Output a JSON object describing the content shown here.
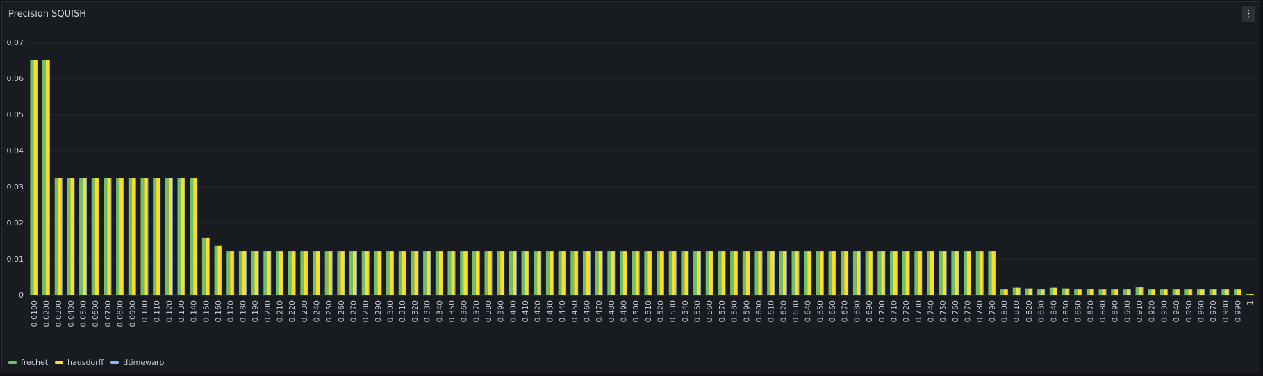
{
  "panel": {
    "title": "Precision SQUISH",
    "menu_icon": "more-vertical-icon"
  },
  "chart_data": {
    "type": "bar",
    "title": "Precision SQUISH",
    "xlabel": "",
    "ylabel": "",
    "ylim": [
      0,
      0.07
    ],
    "yticks": [
      0,
      0.01,
      0.02,
      0.03,
      0.04,
      0.05,
      0.06,
      0.07
    ],
    "ytick_labels": [
      "0",
      "0.01",
      "0.02",
      "0.03",
      "0.04",
      "0.05",
      "0.06",
      "0.07"
    ],
    "grid": true,
    "legend_position": "bottom-left",
    "categories": [
      "0.0100",
      "0.0200",
      "0.0300",
      "0.0400",
      "0.0500",
      "0.0600",
      "0.0700",
      "0.0800",
      "0.0900",
      "0.100",
      "0.110",
      "0.120",
      "0.130",
      "0.140",
      "0.150",
      "0.160",
      "0.170",
      "0.180",
      "0.190",
      "0.200",
      "0.210",
      "0.220",
      "0.230",
      "0.240",
      "0.250",
      "0.260",
      "0.270",
      "0.280",
      "0.290",
      "0.300",
      "0.310",
      "0.320",
      "0.330",
      "0.340",
      "0.350",
      "0.360",
      "0.370",
      "0.380",
      "0.390",
      "0.400",
      "0.410",
      "0.420",
      "0.430",
      "0.440",
      "0.450",
      "0.460",
      "0.470",
      "0.480",
      "0.490",
      "0.500",
      "0.510",
      "0.520",
      "0.530",
      "0.540",
      "0.550",
      "0.560",
      "0.570",
      "0.580",
      "0.590",
      "0.600",
      "0.610",
      "0.620",
      "0.630",
      "0.640",
      "0.650",
      "0.660",
      "0.670",
      "0.680",
      "0.690",
      "0.700",
      "0.710",
      "0.720",
      "0.730",
      "0.740",
      "0.750",
      "0.760",
      "0.770",
      "0.780",
      "0.790",
      "0.800",
      "0.810",
      "0.820",
      "0.830",
      "0.840",
      "0.850",
      "0.860",
      "0.870",
      "0.880",
      "0.890",
      "0.900",
      "0.910",
      "0.920",
      "0.930",
      "0.940",
      "0.950",
      "0.960",
      "0.970",
      "0.980",
      "0.990",
      "1"
    ],
    "series": [
      {
        "name": "frechet",
        "color": "#73bf69",
        "values": [
          0.065,
          0.065,
          0.0323,
          0.0323,
          0.0323,
          0.0323,
          0.0323,
          0.0323,
          0.0323,
          0.0323,
          0.0323,
          0.0323,
          0.0323,
          0.0323,
          0.0158,
          0.0137,
          0.0121,
          0.0121,
          0.0121,
          0.0121,
          0.0121,
          0.0121,
          0.0121,
          0.0121,
          0.0121,
          0.0121,
          0.0121,
          0.0121,
          0.0121,
          0.0121,
          0.0121,
          0.0121,
          0.0121,
          0.0121,
          0.0121,
          0.0121,
          0.0121,
          0.0121,
          0.0121,
          0.0121,
          0.0121,
          0.0121,
          0.0121,
          0.0121,
          0.0121,
          0.0121,
          0.0121,
          0.0121,
          0.0121,
          0.0121,
          0.0121,
          0.0121,
          0.0121,
          0.0121,
          0.0121,
          0.0121,
          0.0121,
          0.0121,
          0.0121,
          0.0121,
          0.0121,
          0.0121,
          0.0121,
          0.0121,
          0.0121,
          0.0121,
          0.0121,
          0.0121,
          0.0121,
          0.0121,
          0.0121,
          0.0121,
          0.0121,
          0.0121,
          0.0121,
          0.0121,
          0.0121,
          0.0121,
          0.0121,
          0.0015,
          0.002,
          0.0018,
          0.0015,
          0.002,
          0.0018,
          0.0015,
          0.0016,
          0.0015,
          0.0015,
          0.0015,
          0.0021,
          0.0015,
          0.0015,
          0.0015,
          0.0015,
          0.0015,
          0.0015,
          0.0015,
          0.0015,
          0.0002
        ]
      },
      {
        "name": "hausdorff",
        "color": "#fade2a",
        "values": [
          0.065,
          0.065,
          0.0323,
          0.0323,
          0.0323,
          0.0323,
          0.0323,
          0.0323,
          0.0323,
          0.0323,
          0.0323,
          0.0323,
          0.0323,
          0.0323,
          0.0158,
          0.0137,
          0.0121,
          0.0121,
          0.0121,
          0.0121,
          0.0121,
          0.0121,
          0.0121,
          0.0121,
          0.0121,
          0.0121,
          0.0121,
          0.0121,
          0.0121,
          0.0121,
          0.0121,
          0.0121,
          0.0121,
          0.0121,
          0.0121,
          0.0121,
          0.0121,
          0.0121,
          0.0121,
          0.0121,
          0.0121,
          0.0121,
          0.0121,
          0.0121,
          0.0121,
          0.0121,
          0.0121,
          0.0121,
          0.0121,
          0.0121,
          0.0121,
          0.0121,
          0.0121,
          0.0121,
          0.0121,
          0.0121,
          0.0121,
          0.0121,
          0.0121,
          0.0121,
          0.0121,
          0.0121,
          0.0121,
          0.0121,
          0.0121,
          0.0121,
          0.0121,
          0.0121,
          0.0121,
          0.0121,
          0.0121,
          0.0121,
          0.0121,
          0.0121,
          0.0121,
          0.0121,
          0.0121,
          0.0121,
          0.0121,
          0.0015,
          0.002,
          0.0018,
          0.0015,
          0.002,
          0.0018,
          0.0015,
          0.0016,
          0.0015,
          0.0015,
          0.0015,
          0.0021,
          0.0015,
          0.0015,
          0.0015,
          0.0015,
          0.0015,
          0.0015,
          0.0015,
          0.0015,
          0.0002
        ]
      },
      {
        "name": "dtimewarp",
        "color": "#8ab8ff",
        "values": [
          0.065,
          0.065,
          0.0323,
          0.0323,
          0.0323,
          0.0323,
          0.0323,
          0.0323,
          0.0323,
          0.0323,
          0.0323,
          0.0323,
          0.0323,
          0.0323,
          0.0158,
          0.0137,
          0.0121,
          0.0121,
          0.0121,
          0.0121,
          0.0121,
          0.0121,
          0.0121,
          0.0121,
          0.0121,
          0.0121,
          0.0121,
          0.0121,
          0.0121,
          0.0121,
          0.0121,
          0.0121,
          0.0121,
          0.0121,
          0.0121,
          0.0121,
          0.0121,
          0.0121,
          0.0121,
          0.0121,
          0.0121,
          0.0121,
          0.0121,
          0.0121,
          0.0121,
          0.0121,
          0.0121,
          0.0121,
          0.0121,
          0.0121,
          0.0121,
          0.0121,
          0.0121,
          0.0121,
          0.0121,
          0.0121,
          0.0121,
          0.0121,
          0.0121,
          0.0121,
          0.0121,
          0.0121,
          0.0121,
          0.0121,
          0.0121,
          0.0121,
          0.0121,
          0.0121,
          0.0121,
          0.0121,
          0.0121,
          0.0121,
          0.0121,
          0.0121,
          0.0121,
          0.0121,
          0.0121,
          0.0121,
          0.0121,
          0.0015,
          0.002,
          0.0018,
          0.0015,
          0.002,
          0.0018,
          0.0015,
          0.0016,
          0.0015,
          0.0015,
          0.0015,
          0.0021,
          0.0015,
          0.0015,
          0.0015,
          0.0015,
          0.0015,
          0.0015,
          0.0015,
          0.0015,
          0.0002
        ]
      }
    ]
  }
}
